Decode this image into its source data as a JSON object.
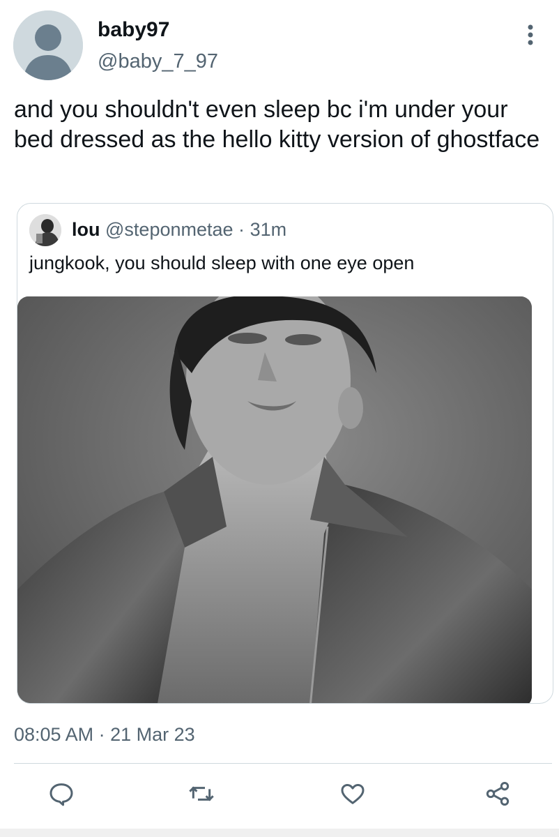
{
  "author": {
    "display_name": "baby97",
    "handle": "@baby_7_97"
  },
  "tweet": {
    "text": "and you shouldn't even sleep bc i'm under your bed dressed as the hello kitty version of ghostface",
    "timestamp": "08:05 AM · 21 Mar 23"
  },
  "quoted_tweet": {
    "display_name": "lou",
    "handle": "@steponmetae",
    "separator": "·",
    "time": "31m",
    "text": "jungkook, you should sleep with one eye open",
    "photo": "black-and-white portrait photo"
  },
  "icons": {
    "more": "more-vertical-icon",
    "reply": "reply-icon",
    "retweet": "retweet-icon",
    "like": "like-icon",
    "share": "share-icon"
  },
  "colors": {
    "text_primary": "#0f1419",
    "text_secondary": "#536471",
    "border": "#cfd9de",
    "avatar_placeholder": "#cfd9de",
    "icon": "#536471"
  }
}
